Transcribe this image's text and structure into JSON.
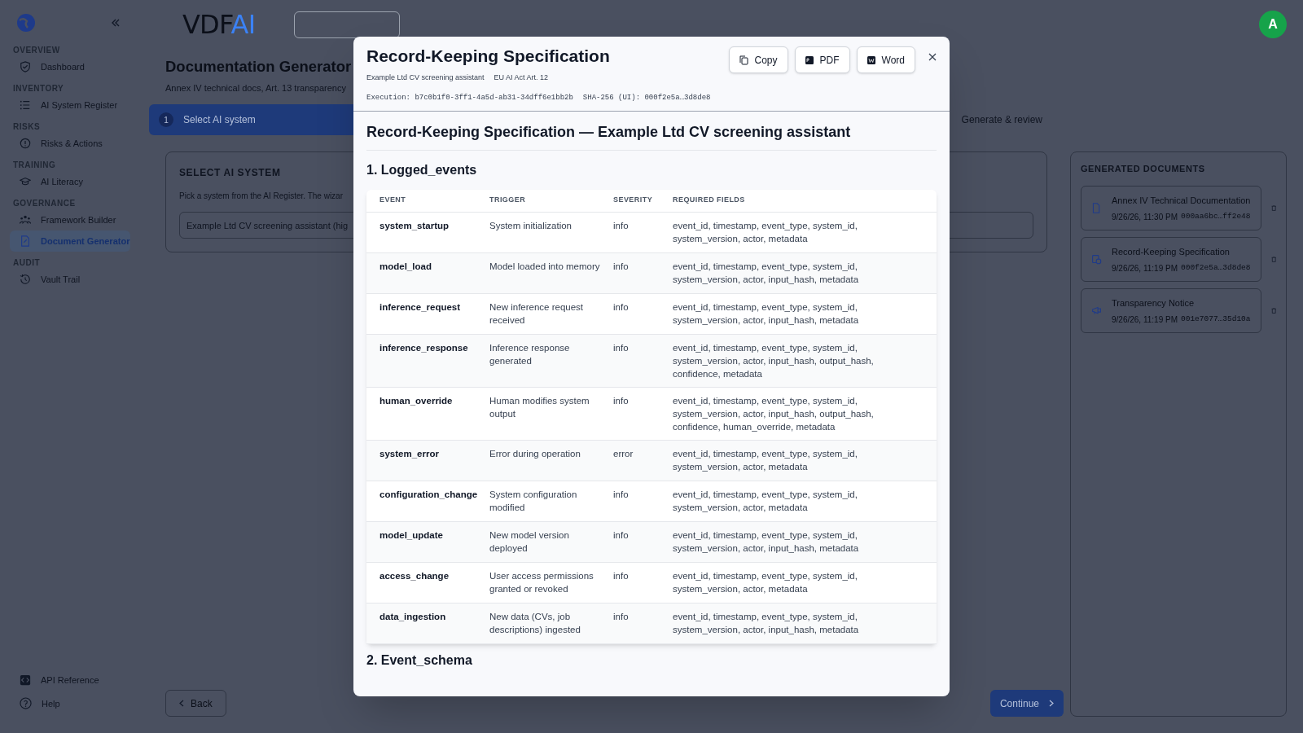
{
  "sidebar": {
    "sections": [
      {
        "heading": "OVERVIEW",
        "items": [
          {
            "label": "Dashboard",
            "selected": false
          }
        ]
      },
      {
        "heading": "INVENTORY",
        "items": [
          {
            "label": "AI System Register",
            "selected": false
          }
        ]
      },
      {
        "heading": "RISKS",
        "items": [
          {
            "label": "Risks & Actions",
            "selected": false
          }
        ]
      },
      {
        "heading": "TRAINING",
        "items": [
          {
            "label": "AI Literacy",
            "selected": false
          }
        ]
      },
      {
        "heading": "GOVERNANCE",
        "items": [
          {
            "label": "Framework Builder",
            "selected": false
          },
          {
            "label": "Document Generator",
            "selected": true
          }
        ]
      },
      {
        "heading": "AUDIT",
        "items": [
          {
            "label": "Vault Trail",
            "selected": false
          }
        ]
      }
    ],
    "footer_items": [
      {
        "label": "API Reference"
      },
      {
        "label": "Help"
      }
    ]
  },
  "header": {
    "logo": {
      "text": "VDF",
      "accent": "AI"
    },
    "avatar": "A"
  },
  "page": {
    "title": "Documentation Generator",
    "subtitle": "Annex IV technical docs, Art. 13 transparency",
    "steps": [
      {
        "number": "1",
        "label": "Select AI system",
        "selected": true
      },
      {
        "label": "Generate & review",
        "selected": false
      }
    ],
    "select_panel": {
      "heading": "SELECT AI SYSTEM",
      "hint": "Pick a system from the AI Register. The wizar",
      "value": "Example Ltd CV screening assistant (hig"
    },
    "generated": {
      "heading": "GENERATED DOCUMENTS",
      "docs": [
        {
          "title": "Annex IV Technical Documentation",
          "date": "9/26/26, 11:30 PM",
          "hash": "000aa6bc…ff2e48"
        },
        {
          "title": "Record-Keeping Specification",
          "date": "9/26/26, 11:19 PM",
          "hash": "000f2e5a…3d8de8"
        },
        {
          "title": "Transparency Notice",
          "date": "9/26/26, 11:19 PM",
          "hash": "001e7077…35d10a"
        }
      ]
    },
    "back": "Back",
    "continue": "Continue"
  },
  "modal": {
    "title": "Record-Keeping Specification",
    "tags": [
      "Example Ltd CV screening assistant",
      "EU AI Act Art. 12"
    ],
    "execution": "Execution: b7c0b1f0-3ff1-4a5d-ab31-34dff6e1bb2b",
    "sha": "SHA-256 (UI): 000f2e5a…3d8de8",
    "buttons": [
      "Copy",
      "PDF",
      "Word"
    ],
    "doc_title": "Record-Keeping Specification — Example Ltd CV screening assistant",
    "section_1": "1. Logged_events",
    "table": {
      "columns": [
        "EVENT",
        "TRIGGER",
        "SEVERITY",
        "REQUIRED FIELDS"
      ],
      "rows": [
        [
          "system_startup",
          "System initialization",
          "info",
          "event_id, timestamp, event_type, system_id, system_version, actor, metadata"
        ],
        [
          "model_load",
          "Model loaded into memory",
          "info",
          "event_id, timestamp, event_type, system_id, system_version, actor, input_hash, metadata"
        ],
        [
          "inference_request",
          "New inference request received",
          "info",
          "event_id, timestamp, event_type, system_id, system_version, actor, input_hash, metadata"
        ],
        [
          "inference_response",
          "Inference response generated",
          "info",
          "event_id, timestamp, event_type, system_id, system_version, actor, input_hash, output_hash, confidence, metadata"
        ],
        [
          "human_override",
          "Human modifies system output",
          "info",
          "event_id, timestamp, event_type, system_id, system_version, actor, input_hash, output_hash, confidence, human_override, metadata"
        ],
        [
          "system_error",
          "Error during operation",
          "error",
          "event_id, timestamp, event_type, system_id, system_version, actor, metadata"
        ],
        [
          "configuration_change",
          "System configuration modified",
          "info",
          "event_id, timestamp, event_type, system_id, system_version, actor, metadata"
        ],
        [
          "model_update",
          "New model version deployed",
          "info",
          "event_id, timestamp, event_type, system_id, system_version, actor, input_hash, metadata"
        ],
        [
          "access_change",
          "User access permissions granted or revoked",
          "info",
          "event_id, timestamp, event_type, system_id, system_version, actor, metadata"
        ],
        [
          "data_ingestion",
          "New data (CVs, job descriptions) ingested",
          "info",
          "event_id, timestamp, event_type, system_id, system_version, actor, input_hash, metadata"
        ]
      ]
    },
    "section_2": "2. Event_schema"
  }
}
